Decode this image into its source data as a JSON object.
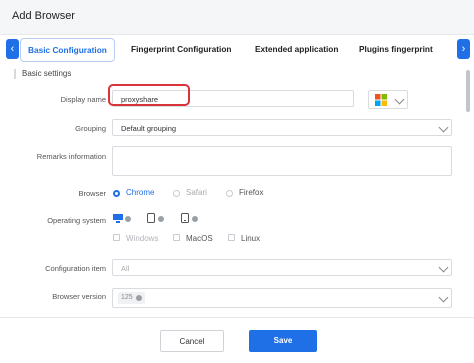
{
  "window": {
    "title": "Add Browser"
  },
  "tabs": [
    {
      "label": "Basic Configuration",
      "active": true
    },
    {
      "label": "Fingerprint Configuration"
    },
    {
      "label": "Extended application"
    },
    {
      "label": "Plugins fingerprint"
    }
  ],
  "section": {
    "title": "Basic settings"
  },
  "form": {
    "display_name": {
      "label": "Display name",
      "value": "proxyshare"
    },
    "grouping": {
      "label": "Grouping",
      "value": "Default grouping"
    },
    "remarks": {
      "label": "Remarks information",
      "value": ""
    },
    "browser": {
      "label": "Browser",
      "options": [
        "Chrome",
        "Safari",
        "Firefox"
      ],
      "selected": "Chrome"
    },
    "os": {
      "label": "Operating system",
      "icons": [
        "windows-icon",
        "android-icon",
        "ios-icon"
      ],
      "options": [
        "Windows",
        "MacOS",
        "Linux"
      ]
    },
    "config_item": {
      "label": "Configuration item",
      "value": "All"
    },
    "browser_version": {
      "label": "Browser version",
      "value": "125"
    }
  },
  "footer": {
    "cancel_label": "Cancel",
    "save_label": "Save"
  },
  "colors": {
    "accent": "#1f6fe6",
    "highlight": "#d9343a"
  }
}
